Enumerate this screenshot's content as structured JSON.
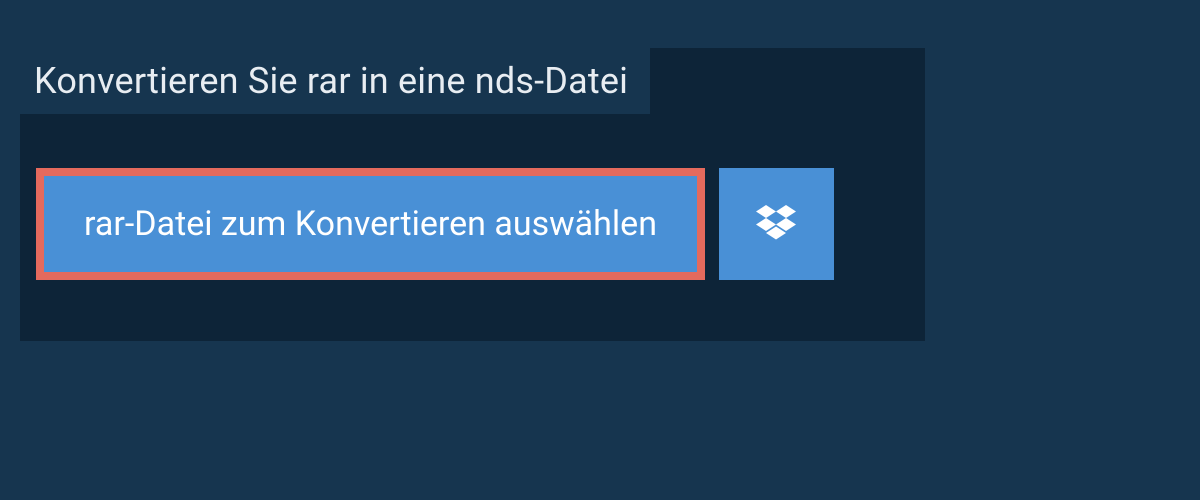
{
  "title": "Konvertieren Sie rar in eine nds-Datei",
  "selectButton": {
    "label": "rar-Datei zum Konvertieren auswählen"
  },
  "colors": {
    "pageBackground": "#16354f",
    "panelBackground": "#0d2438",
    "buttonBackground": "#4990d6",
    "highlightBorder": "#e46a5d",
    "textColor": "#ffffff"
  }
}
